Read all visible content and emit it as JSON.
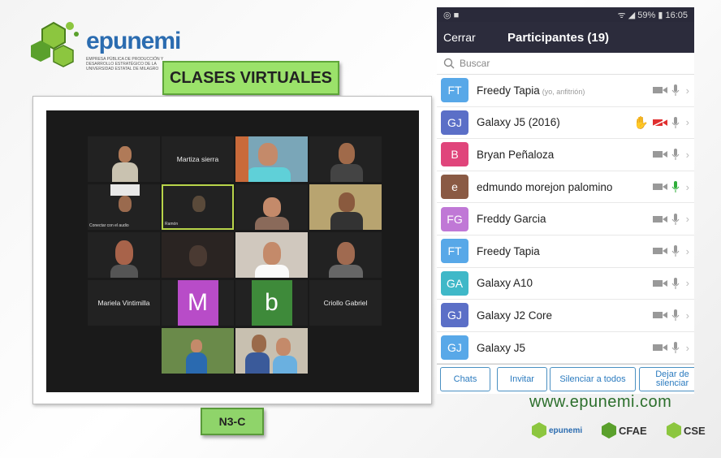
{
  "brand": {
    "name": "epunemi",
    "tagline": "EMPRESA PÚBLICA DE PRODUCCIÓN Y DESARROLLO ESTRATÉGICO DE LA UNIVERSIDAD ESTATAL DE MILAGRO"
  },
  "slide": {
    "title": "CLASES VIRTUALES",
    "section": "N3-C"
  },
  "gallery": {
    "names": {
      "martiza": "Martiza sierra",
      "conectar": "Conectar con el audio",
      "ramon": "Ramón",
      "mariela": "Mariela Vintimilla",
      "criollo": "Criollo Gabriel"
    },
    "letters": {
      "m": "M",
      "b": "b"
    }
  },
  "phone": {
    "status": {
      "left_icons": "◎ ■",
      "right": "ᯤ ◢ 59% ▮ 16:05"
    },
    "header": {
      "close": "Cerrar",
      "title": "Participantes (19)"
    },
    "search_placeholder": "Buscar",
    "participants": [
      {
        "initials": "FT",
        "name": "Freedy Tapia",
        "role": "(yo, anfitrión)",
        "color": "#58a8e8",
        "mic": "gray",
        "video": "on"
      },
      {
        "initials": "GJ",
        "name": "Galaxy J5 (2016)",
        "role": "",
        "color": "#5b6fc7",
        "mic": "gray",
        "video": "off",
        "hand": true
      },
      {
        "initials": "B",
        "name": "Bryan Peñaloza",
        "role": "",
        "color": "#e0457b",
        "mic": "gray",
        "video": "on"
      },
      {
        "initials": "e",
        "name": "edmundo morejon palomino",
        "role": "",
        "color": "#8a5a44",
        "mic": "green",
        "video": "on"
      },
      {
        "initials": "FG",
        "name": "Freddy Garcia",
        "role": "",
        "color": "#c078d6",
        "mic": "gray",
        "video": "on"
      },
      {
        "initials": "FT",
        "name": "Freedy Tapia",
        "role": "",
        "color": "#58a8e8",
        "mic": "gray",
        "video": "on"
      },
      {
        "initials": "GA",
        "name": "Galaxy A10",
        "role": "",
        "color": "#3fb8c8",
        "mic": "gray",
        "video": "on"
      },
      {
        "initials": "GJ",
        "name": "Galaxy J2 Core",
        "role": "",
        "color": "#5b6fc7",
        "mic": "gray",
        "video": "on"
      },
      {
        "initials": "GJ",
        "name": "Galaxy J5",
        "role": "",
        "color": "#58a8e8",
        "mic": "gray",
        "video": "on"
      }
    ],
    "buttons": {
      "chats": "Chats",
      "invitar": "Invitar",
      "silenciar": "Silenciar a todos",
      "dejar": "Dejar de silenciar"
    }
  },
  "footer": {
    "url": "www.epunemi.com",
    "logo1": "epunemi",
    "logo2": "CFAE",
    "logo3": "CSE"
  }
}
